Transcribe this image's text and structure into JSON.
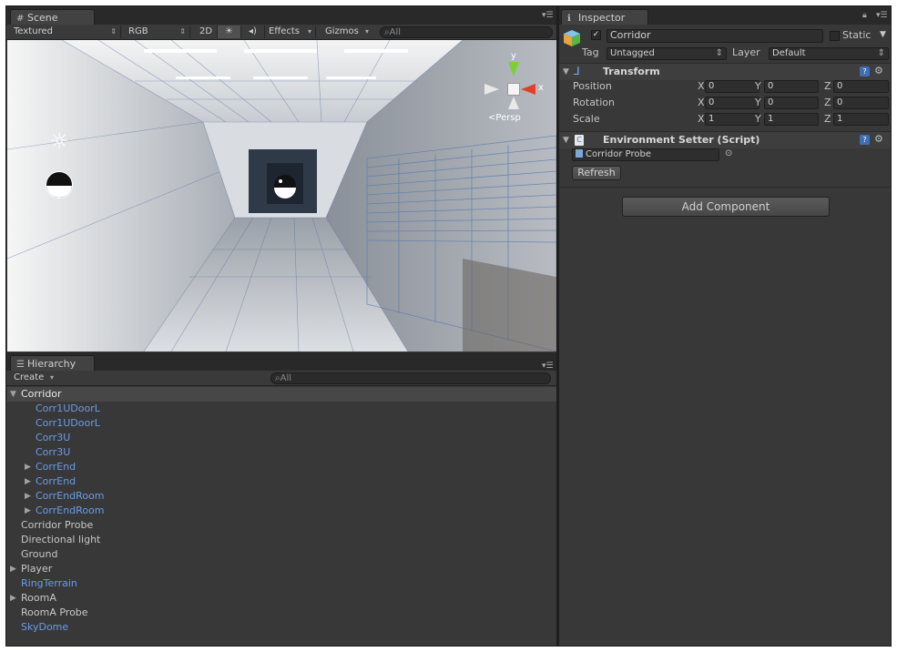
{
  "scene": {
    "tab_label": "Scene",
    "toolbar": {
      "render_mode": "Textured",
      "color_mode": "RGB",
      "mode_2d": "2D",
      "effects": "Effects",
      "gizmos": "Gizmos",
      "search_placeholder": "All"
    },
    "gizmo": {
      "y_label": "y",
      "x_label": "x",
      "projection": "Persp"
    }
  },
  "hierarchy": {
    "tab_label": "Hierarchy",
    "create_label": "Create",
    "search_placeholder": "All",
    "items": [
      {
        "label": "Corridor"
      },
      {
        "label": "Corr1UDoorL"
      },
      {
        "label": "Corr1UDoorL"
      },
      {
        "label": "Corr3U"
      },
      {
        "label": "Corr3U"
      },
      {
        "label": "CorrEnd"
      },
      {
        "label": "CorrEnd"
      },
      {
        "label": "CorrEndRoom"
      },
      {
        "label": "CorrEndRoom"
      },
      {
        "label": "Corridor Probe"
      },
      {
        "label": "Directional light"
      },
      {
        "label": "Ground"
      },
      {
        "label": "Player"
      },
      {
        "label": "RingTerrain"
      },
      {
        "label": "RoomA"
      },
      {
        "label": "RoomA Probe"
      },
      {
        "label": "SkyDome"
      }
    ]
  },
  "inspector": {
    "tab_label": "Inspector",
    "object_name": "Corridor",
    "static_label": "Static",
    "tag_label": "Tag",
    "tag_value": "Untagged",
    "layer_label": "Layer",
    "layer_value": "Default",
    "transform": {
      "title": "Transform",
      "position_label": "Position",
      "rotation_label": "Rotation",
      "scale_label": "Scale",
      "axis_x": "X",
      "axis_y": "Y",
      "axis_z": "Z",
      "position": [
        "0",
        "0",
        "0"
      ],
      "rotation": [
        "0",
        "0",
        "0"
      ],
      "scale": [
        "1",
        "1",
        "1"
      ]
    },
    "env_setter": {
      "title": "Environment Setter (Script)",
      "probe_value": "Corridor Probe",
      "refresh_label": "Refresh"
    },
    "add_component_label": "Add Component"
  },
  "colors": {
    "prefab_text": "#6a9ce8",
    "selection": "#474747",
    "panel_bg": "#383838"
  }
}
